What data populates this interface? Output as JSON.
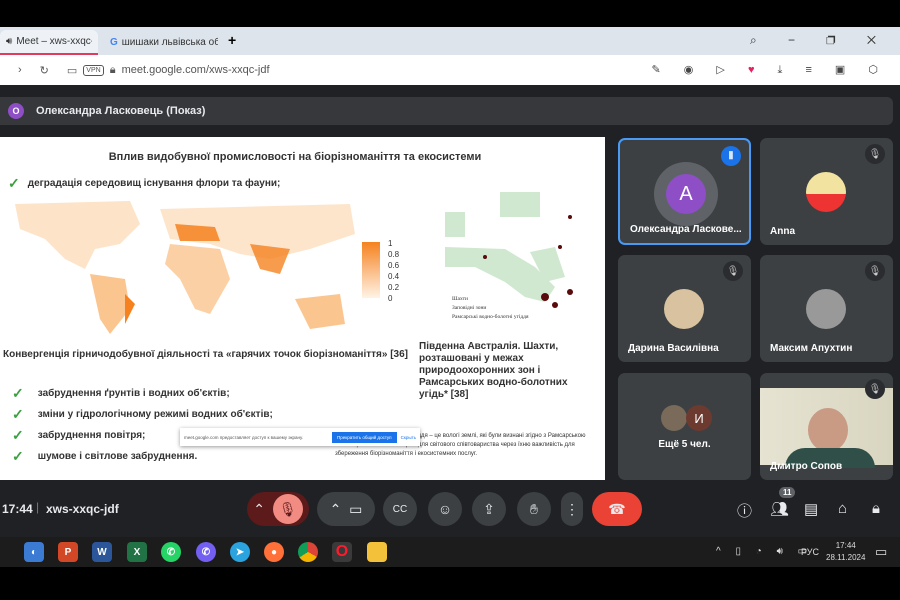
{
  "browser": {
    "tab1": "Meet – xws-xxqc-jdf",
    "tab2": "шишаки львівська облас",
    "new_tab": "+",
    "vpn": "VPN",
    "url": "meet.google.com/xws-xxqc-jdf"
  },
  "presenter": {
    "initial": "О",
    "label": "Олександра Ласковець (Показ)"
  },
  "slide": {
    "title": "Вплив видобувної промисловості на біорізноманіття та екосистеми",
    "bullet1": "деградація середовищ існування флори та фауни;",
    "legend_ticks": [
      "1",
      "0.8",
      "0.6",
      "0.4",
      "0.2",
      "0"
    ],
    "map_legend": [
      "Шахти",
      "Заповідні зони",
      "Рамсарські водно-болотні угіддя"
    ],
    "caption_left": "Конвергенція гірничодобувної діяльності та «гарячих точок біорізноманіття» [36]",
    "caption_right": "Південна Австралія. Шахти, розташовані у межах природоохоронних зон і Рамсарських водно-болотних угідь* [38]",
    "bullets": [
      "забруднення ґрунтів і водних об'єктів;",
      "зміни у гідрологічному режимі водних об'єктів;",
      "забруднення повітря;",
      "шумове і світлове забруднення."
    ],
    "footnote": "*Рамсарські водно-болотні угіддя – це вологі землі, які були визнані згідно з Рамсарською конвенцією як особливо цінні для світового співтовариства через їхню важливість для збереження біорізноманіття і екосистемних послуг.",
    "share_notice": {
      "text": "meet.google.com предоставляет доступ к вашему экрану.",
      "stop": "Прекратить общий доступ",
      "hide": "Скрыть"
    }
  },
  "tiles": [
    {
      "name": "Олександра Ласкове...",
      "initial": "А",
      "speaking": true
    },
    {
      "name": "Anna"
    },
    {
      "name": "Дарина Василівна"
    },
    {
      "name": "Максим Апухтин"
    },
    {
      "name": "Ещё 5 чел.",
      "initial": "И"
    },
    {
      "name": "Дмитро Сопов"
    }
  ],
  "controls": {
    "time": "17:44",
    "code": "xws-xxqc-jdf",
    "participants_count": "11"
  },
  "taskbar": {
    "lang": "РУС",
    "time": "17:44",
    "date": "28.11.2024"
  },
  "colors": {
    "accent": "#1a73e8",
    "end_call": "#ea4335",
    "heat": "#f5821f"
  }
}
